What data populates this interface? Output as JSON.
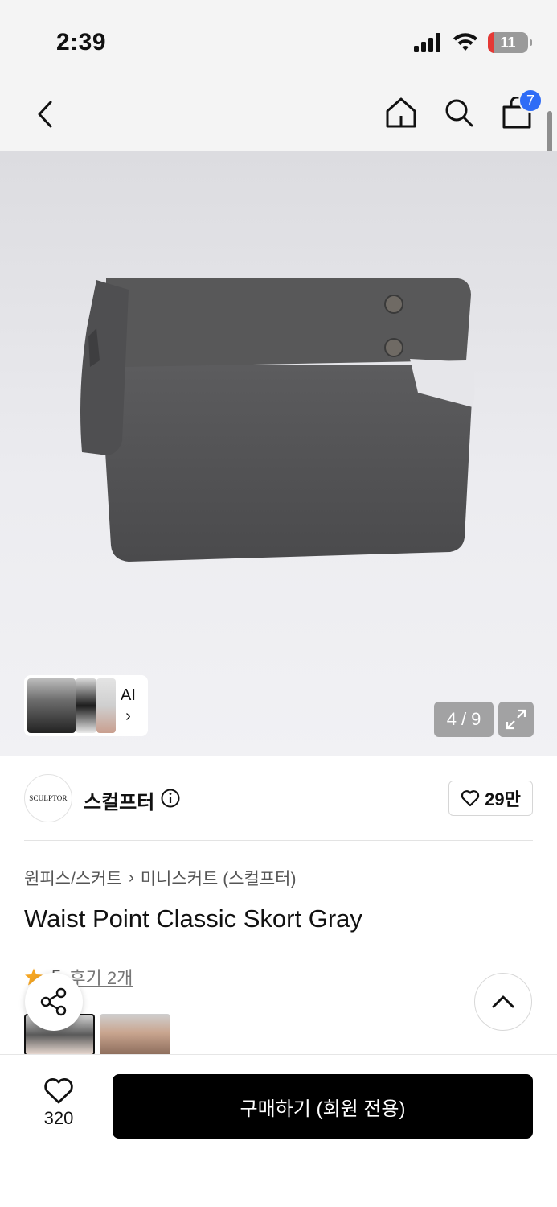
{
  "status_bar": {
    "time": "2:39",
    "battery": "11"
  },
  "nav": {
    "cart_count": "7"
  },
  "gallery": {
    "current": "4",
    "total": "9",
    "ai_label": "AI",
    "ai_chevron": "›"
  },
  "brand": {
    "name": "스컬프터",
    "logo_text": "SCULPTOR",
    "follow_count": "29만"
  },
  "product": {
    "breadcrumb_category": "원피스/스커트",
    "breadcrumb_sep": "›",
    "breadcrumb_sub": "미니스커트 (스컬프터)",
    "title": "Waist Point Classic Skort Gray",
    "rating": "5",
    "review_text": "후기 2개"
  },
  "bottom": {
    "like_count": "320",
    "buy_label": "구매하기 (회원 전용)"
  },
  "colors": {
    "badge_blue": "#2f6cf6",
    "star": "#f5a623",
    "buy_bg": "#000000"
  }
}
